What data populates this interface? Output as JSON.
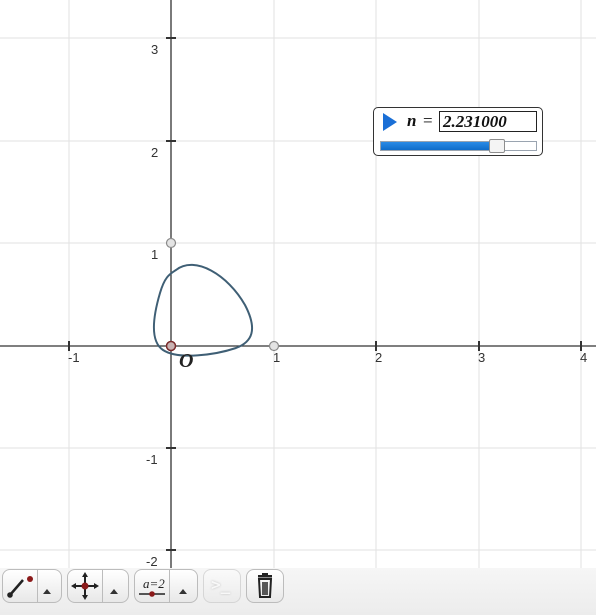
{
  "axes": {
    "x_ticks": [
      "-1",
      "1",
      "2",
      "3",
      "4"
    ],
    "y_ticks": [
      "3",
      "2",
      "1",
      "-1",
      "-2"
    ],
    "origin_label": "O"
  },
  "curve": {
    "color": "#3f5f75"
  },
  "slider": {
    "variable": "n",
    "equals": "=",
    "value_text": "2.231000",
    "fill_fraction": 0.75,
    "accent_color": "#1a6fd6"
  },
  "toolbar": {
    "tools": [
      {
        "name": "segment-tool",
        "icon": "segment-point-icon"
      },
      {
        "name": "move-tool",
        "icon": "crosshair-move-icon"
      },
      {
        "name": "parameter-tool",
        "icon": "parameter-icon",
        "label": "a=2"
      },
      {
        "name": "calculator",
        "icon": "calculator-prompt-icon",
        "label": ">_"
      },
      {
        "name": "delete",
        "icon": "trash-icon"
      }
    ]
  }
}
